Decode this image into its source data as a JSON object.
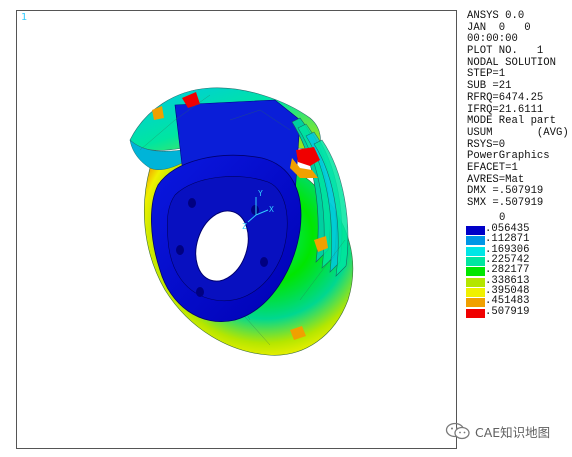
{
  "window_number": "1",
  "info_lines": [
    "ANSYS 0.0",
    "JAN  0   0",
    "00:00:00",
    "PLOT NO.   1",
    "NODAL SOLUTION",
    "STEP=1",
    "SUB =21",
    "RFRQ=6474.25",
    "IFRQ=21.6111",
    "MODE Real part",
    "USUM       (AVG)",
    "RSYS=0",
    "PowerGraphics",
    "EFACET=1",
    "AVRES=Mat",
    "DMX =.507919",
    "SMX =.507919"
  ],
  "legend": {
    "top_label": "0",
    "entries": [
      {
        "label": ".056435",
        "color": "#0000c8"
      },
      {
        "label": ".112871",
        "color": "#0096e6"
      },
      {
        "label": ".169306",
        "color": "#00e6e6"
      },
      {
        "label": ".225742",
        "color": "#00e6a0"
      },
      {
        "label": ".282177",
        "color": "#00e600"
      },
      {
        "label": ".338613",
        "color": "#b4e600"
      },
      {
        "label": ".395048",
        "color": "#f0f000"
      },
      {
        "label": ".451483",
        "color": "#f0a000"
      },
      {
        "label": ".507919",
        "color": "#f00000"
      }
    ]
  },
  "axis_triad": {
    "y_label": "Y",
    "x_label": "X",
    "z_label": "Z"
  },
  "watermark": {
    "text": "CAE知识地图",
    "icon": "wechat-icon"
  }
}
